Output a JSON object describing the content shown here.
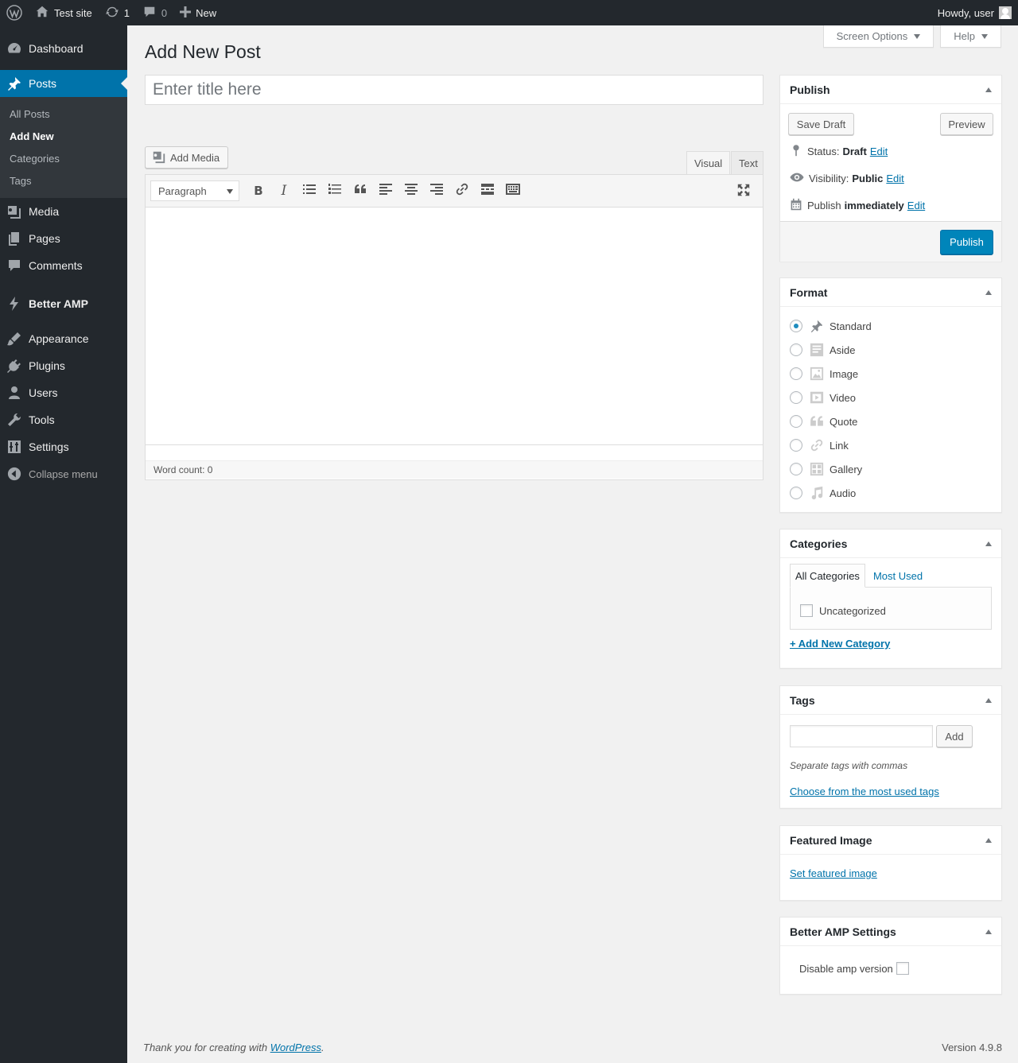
{
  "adminbar": {
    "site_name": "Test site",
    "updates_count": "1",
    "comments_count": "0",
    "new_label": "New",
    "greeting": "Howdy, user"
  },
  "menu": {
    "dashboard": "Dashboard",
    "posts": "Posts",
    "posts_sub": [
      "All Posts",
      "Add New",
      "Categories",
      "Tags"
    ],
    "media": "Media",
    "pages": "Pages",
    "comments": "Comments",
    "better_amp": "Better AMP",
    "appearance": "Appearance",
    "plugins": "Plugins",
    "users": "Users",
    "tools": "Tools",
    "settings": "Settings",
    "collapse": "Collapse menu"
  },
  "screen_options_label": "Screen Options",
  "help_label": "Help",
  "page_title": "Add New Post",
  "title_placeholder": "Enter title here",
  "editor": {
    "add_media": "Add Media",
    "tab_visual": "Visual",
    "tab_text": "Text",
    "format_value": "Paragraph",
    "word_count": "Word count: 0"
  },
  "publish": {
    "title": "Publish",
    "save_draft": "Save Draft",
    "preview": "Preview",
    "status_label": "Status:",
    "status_value": "Draft",
    "visibility_label": "Visibility:",
    "visibility_value": "Public",
    "publish_label": "Publish",
    "publish_value": "immediately",
    "edit": "Edit",
    "publish_button": "Publish"
  },
  "format": {
    "title": "Format",
    "options": [
      "Standard",
      "Aside",
      "Image",
      "Video",
      "Quote",
      "Link",
      "Gallery",
      "Audio"
    ],
    "selected": "Standard"
  },
  "categories": {
    "title": "Categories",
    "tab_all": "All Categories",
    "tab_most_used": "Most Used",
    "items": [
      "Uncategorized"
    ],
    "add_new": "+ Add New Category"
  },
  "tags": {
    "title": "Tags",
    "add_button": "Add",
    "hint": "Separate tags with commas",
    "choose_link": "Choose from the most used tags"
  },
  "featured_image": {
    "title": "Featured Image",
    "link": "Set featured image"
  },
  "better_amp_settings": {
    "title": "Better AMP Settings",
    "disable_label": "Disable amp version"
  },
  "footer": {
    "thanks_prefix": "Thank you for creating with ",
    "thanks_link": "WordPress",
    "thanks_suffix": ".",
    "version": "Version 4.9.8"
  },
  "colors": {
    "accent": "#0073aa",
    "adminbar_bg": "#23282d",
    "publish_button": "#0085ba"
  }
}
